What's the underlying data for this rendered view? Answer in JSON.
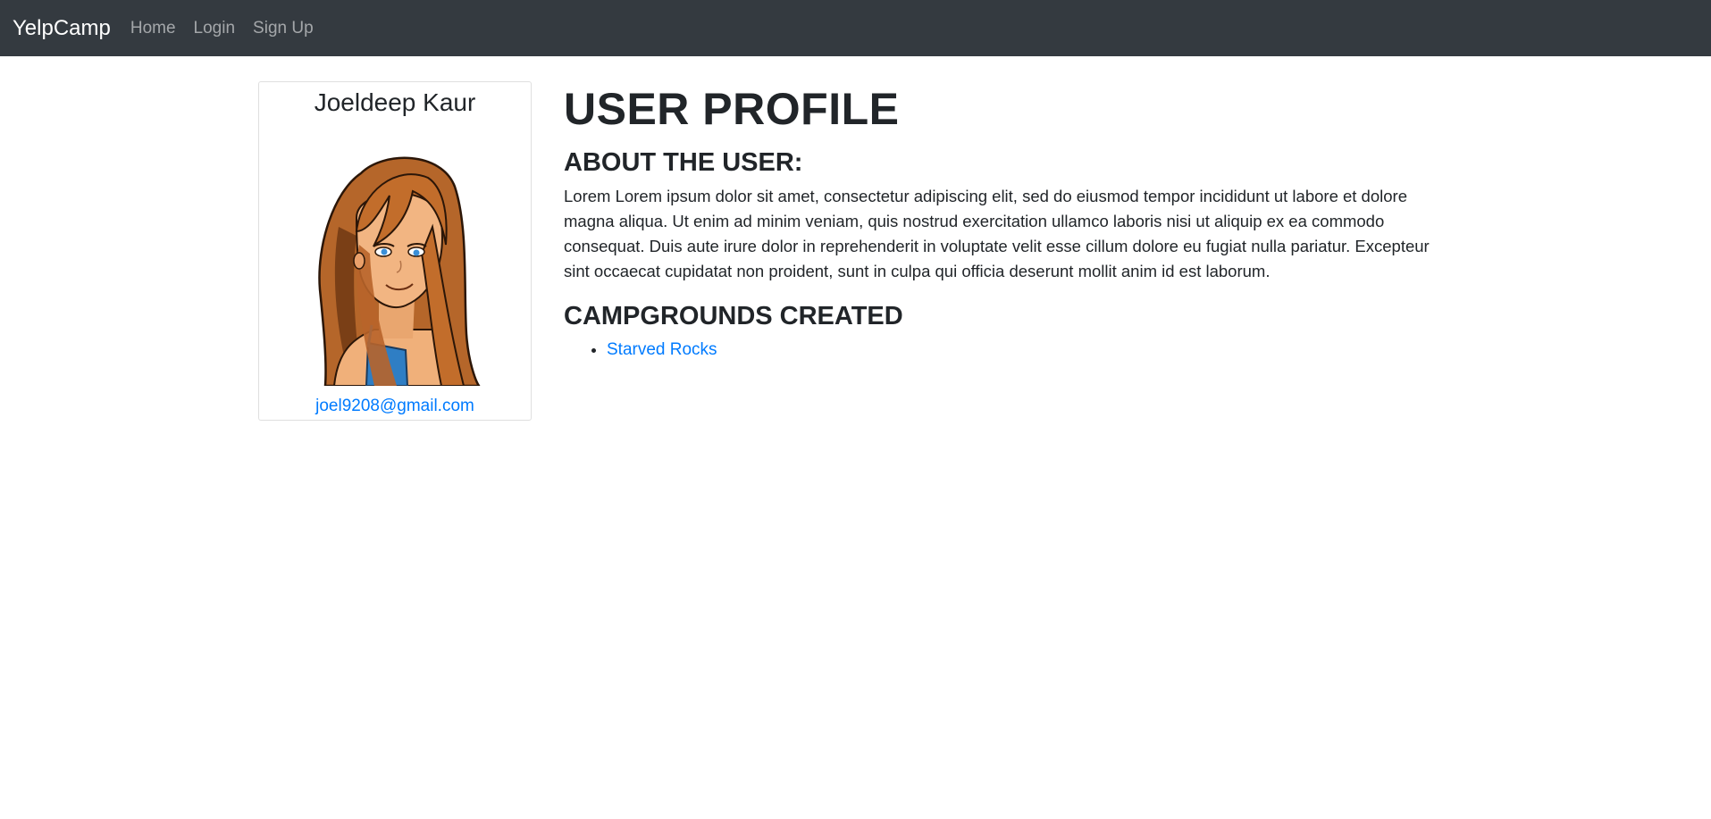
{
  "navbar": {
    "brand": "YelpCamp",
    "links": [
      "Home",
      "Login",
      "Sign Up"
    ]
  },
  "profile_card": {
    "name": "Joeldeep Kaur",
    "email": "joel9208@gmail.com",
    "avatar": "cartoon-girl-avatar"
  },
  "main": {
    "title": "USER PROFILE",
    "about_heading": "ABOUT THE USER:",
    "about_text": "Lorem Lorem ipsum dolor sit amet, consectetur adipiscing elit, sed do eiusmod tempor incididunt ut labore et dolore magna aliqua. Ut enim ad minim veniam, quis nostrud exercitation ullamco laboris nisi ut aliquip ex ea commodo consequat. Duis aute irure dolor in reprehenderit in voluptate velit esse cillum dolore eu fugiat nulla pariatur. Excepteur sint occaecat cupidatat non proident, sunt in culpa qui officia deserunt mollit anim id est laborum.",
    "campgrounds_heading": "CAMPGROUNDS CREATED",
    "campgrounds": [
      "Starved Rocks"
    ]
  },
  "colors": {
    "navbar_bg": "#343a40",
    "link": "#007bff",
    "text": "#212529"
  }
}
